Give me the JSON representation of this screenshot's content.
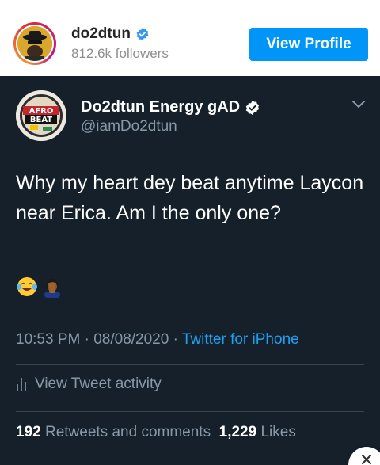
{
  "instagram": {
    "username": "do2dtun",
    "followers": "812.6k followers",
    "view_profile_label": "View Profile",
    "colors": {
      "button": "#0095f6"
    }
  },
  "tweet": {
    "display_name": "Do2dtun Energy gAD",
    "handle": "@iamDo2dtun",
    "avatar_text": [
      "AFRO",
      "BEAT"
    ],
    "text": "Why my heart dey beat anytime Laycon near Erica. Am I the only one?",
    "emojis": [
      "face-with-tears-of-joy",
      "person-facepalming"
    ],
    "time": "10:53 PM",
    "date": "08/08/2020",
    "source": "Twitter for iPhone",
    "activity_label": "View Tweet activity",
    "retweets_count": "192",
    "retweets_label": "Retweets and comments",
    "likes_count": "1,229",
    "likes_label": "Likes",
    "colors": {
      "background": "#15202b",
      "secondary": "#8899a6",
      "link": "#1da1f2"
    }
  }
}
